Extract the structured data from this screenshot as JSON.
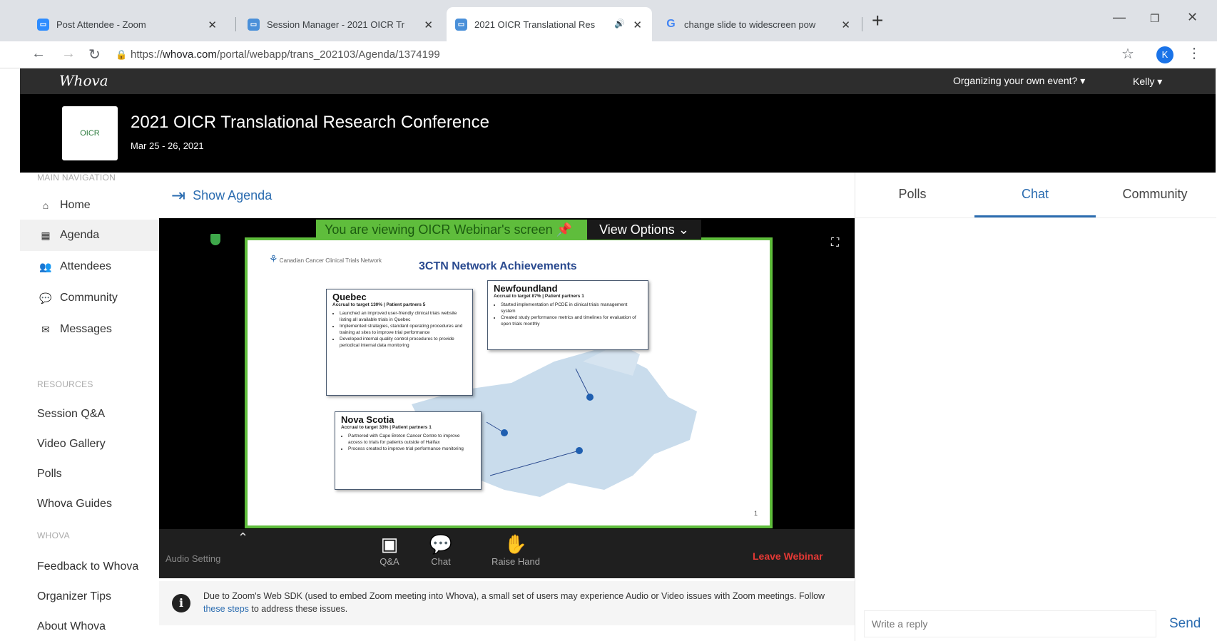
{
  "browser": {
    "tabs": [
      {
        "title": "Post Attendee - Zoom",
        "favicon_color": "#2d8cff"
      },
      {
        "title": "Session Manager - 2021 OICR Tr",
        "favicon_color": "#4a90d9"
      },
      {
        "title": "2021 OICR Translational Res",
        "favicon_color": "#4a90d9"
      },
      {
        "title": "change slide to widescreen pow",
        "favicon_letter": "G"
      }
    ],
    "url_prefix": "https://",
    "url_host": "whova.com",
    "url_path": "/portal/webapp/trans_202103/Agenda/1374199",
    "profile_initial": "K"
  },
  "topbar": {
    "logo": "Whova",
    "organizing": "Organizing your own event? ▾",
    "user": "Kelly ▾"
  },
  "banner": {
    "logo_text": "OICR",
    "title": "2021 OICR Translational Research Conference",
    "dates": "Mar 25 - 26, 2021"
  },
  "sidebar": {
    "main_heading": "MAIN NAVIGATION",
    "main_items": [
      {
        "label": "Home",
        "icon": "home-icon"
      },
      {
        "label": "Agenda",
        "icon": "calendar-icon"
      },
      {
        "label": "Attendees",
        "icon": "users-icon"
      },
      {
        "label": "Community",
        "icon": "community-icon"
      },
      {
        "label": "Messages",
        "icon": "envelope-icon"
      }
    ],
    "resources_heading": "RESOURCES",
    "resources_items": [
      "Session Q&A",
      "Video Gallery",
      "Polls",
      "Whova Guides"
    ],
    "whova_heading": "WHOVA",
    "whova_items": [
      "Feedback to Whova",
      "Organizer Tips",
      "About Whova"
    ]
  },
  "show_agenda": "Show Agenda",
  "zoom": {
    "viewing_banner": "You are viewing OICR Webinar's screen",
    "view_options": "View Options",
    "slide": {
      "logo_text": "Canadian Cancer Clinical Trials Network",
      "title": "3CTN Network Achievements",
      "page": "1",
      "boxes": [
        {
          "name": "Quebec",
          "sub": "Accrual to target 130% | Patient partners 5",
          "bullets": [
            "Launched an improved user-friendly clinical trials website listing all available trials in Quebec",
            "Implemented strategies, standard operating procedures and training at sites to improve trial performance",
            "Developed internal quality control procedures to provide periodical internal data monitoring"
          ]
        },
        {
          "name": "Newfoundland",
          "sub": "Accrual to target 87% | Patient partners 1",
          "bullets": [
            "Started implementation of PCDE in clinical trials management system",
            "Created study performance metrics and timelines for evaluation of open trials monthly"
          ]
        },
        {
          "name": "Nova Scotia",
          "sub": "Accrual to target 33% | Patient partners 1",
          "bullets": [
            "Partnered with Cape Breton Cancer Centre to improve access to trials for patients outside of Halifax",
            "Process created to improve trial performance monitoring"
          ]
        }
      ]
    },
    "toolbar": {
      "audio_setting": "Audio Setting",
      "qa": "Q&A",
      "chat": "Chat",
      "raise_hand": "Raise Hand",
      "leave": "Leave Webinar"
    }
  },
  "notice": {
    "text_before": "Due to Zoom's Web SDK (used to embed Zoom meeting into Whova), a small set of users may experience Audio or Video issues with Zoom meetings. Follow ",
    "link": "these steps",
    "text_after": " to address these issues."
  },
  "right_panel": {
    "tabs": [
      "Polls",
      "Chat",
      "Community"
    ],
    "active_tab": "Chat",
    "reply_placeholder": "Write a reply",
    "send": "Send"
  },
  "colors": {
    "accent_blue": "#2b6cb0",
    "zoom_green": "#5fbd3c",
    "leave_red": "#e53935"
  }
}
